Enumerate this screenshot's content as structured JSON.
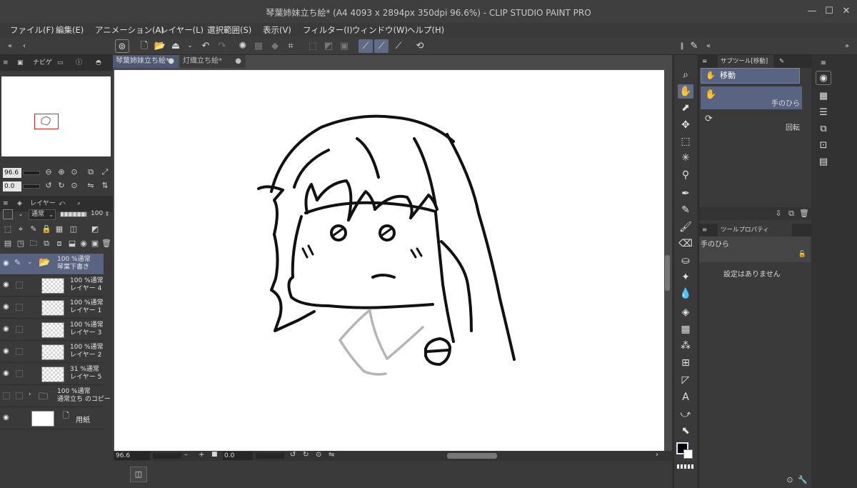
{
  "window": {
    "title": "琴葉姉妹立ち絵* (A4 4093 x 2894px 350dpi 96.6%)  - CLIP STUDIO PAINT PRO",
    "minimize": "—",
    "maximize": "☐",
    "close": "✕"
  },
  "menu": [
    "ファイル(F)",
    "編集(E)",
    "アニメーション(A)",
    "レイヤー(L)",
    "選択範囲(S)",
    "表示(V)",
    "フィルター(I)",
    "ウィンドウ(W)",
    "ヘルプ(H)"
  ],
  "navigator": {
    "tab_label": "ナビゲ",
    "zoom": "96.6",
    "angle": "0.0"
  },
  "layers_panel": {
    "tab_label": "レイヤー",
    "blend_mode": "通常",
    "opacity": "100",
    "layers": [
      {
        "line1": "100 %通常",
        "line2": "琴葉下書き"
      },
      {
        "line1": "100 %通常",
        "line2": "レイヤー 4"
      },
      {
        "line1": "100 %通常",
        "line2": "レイヤー 1"
      },
      {
        "line1": "100 %通常",
        "line2": "レイヤー 3"
      },
      {
        "line1": "100 %通常",
        "line2": "レイヤー 2"
      },
      {
        "line1": "31 %通常",
        "line2": "レイヤー 5"
      },
      {
        "line1": "100 %通常",
        "line2": "通常立ち のコピー"
      },
      {
        "line1": "",
        "line2": "用紙"
      }
    ]
  },
  "documents": {
    "tabs": [
      "琴葉姉妹立ち絵*",
      "灯織立ち絵*"
    ],
    "active_tab": 0
  },
  "status": {
    "zoom": "96.6",
    "angle": "0.0"
  },
  "subtool_panel": {
    "tab_label": "サブツール[移動]",
    "group_label": "移動",
    "items": [
      "手のひら",
      "回転"
    ]
  },
  "tool_property": {
    "tab_label": "ツールプロパティ",
    "tool_name": "手のひら",
    "message": "設定はありません"
  },
  "colors": {
    "main": "#000000",
    "sub": "#ffffff",
    "accent": "#586482"
  }
}
